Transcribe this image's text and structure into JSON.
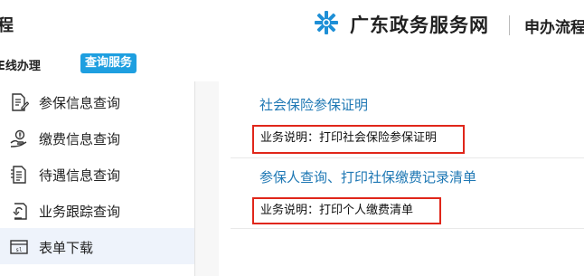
{
  "header": {
    "left_fragment": "程",
    "site_name": "广东政务服务网",
    "right_fragment": "申办流程"
  },
  "subheader": {
    "left_fragment": "E线办理",
    "query_button": "查询服务"
  },
  "sidebar": {
    "items": [
      {
        "label": "参保信息查询",
        "icon": "document-edit-icon",
        "active": false
      },
      {
        "label": "缴费信息查询",
        "icon": "hand-coin-icon",
        "active": false
      },
      {
        "label": "待遇信息查询",
        "icon": "document-list-icon",
        "active": false
      },
      {
        "label": "业务跟踪查询",
        "icon": "tracking-arrow-icon",
        "active": false
      },
      {
        "label": "表单下载",
        "icon": "form-download-icon",
        "active": true
      }
    ]
  },
  "services": [
    {
      "title": "社会保险参保证明",
      "description": "业务说明：打印社会保险参保证明"
    },
    {
      "title": "参保人查询、打印社保缴费记录清单",
      "description": "业务说明：打印个人缴费清单"
    }
  ],
  "colors": {
    "accent": "#1e9fe0",
    "link": "#1f78b4",
    "highlight_border": "#e0261a",
    "active_bg": "#eef3fb"
  }
}
